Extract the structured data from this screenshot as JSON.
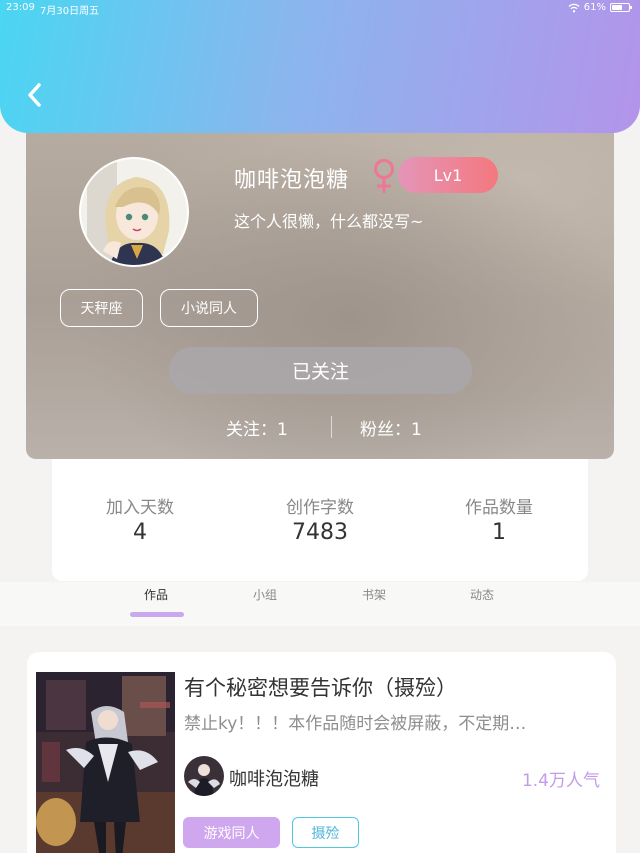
{
  "status_bar": {
    "time": "23:09",
    "date": "7月30日周五",
    "battery": "61%"
  },
  "profile": {
    "username": "咖啡泡泡糖",
    "gender_icon": "female-icon",
    "level": "Lv1",
    "bio": "这个人很懒，什么都没写~",
    "tags": [
      "天秤座",
      "小说同人"
    ],
    "follow_label": "已关注",
    "following_label": "关注：1",
    "fans_label": "粉丝：1"
  },
  "counts": [
    {
      "label": "加入天数",
      "value": "4"
    },
    {
      "label": "创作字数",
      "value": "7483"
    },
    {
      "label": "作品数量",
      "value": "1"
    }
  ],
  "tabs": [
    {
      "label": "作品"
    },
    {
      "label": "小组"
    },
    {
      "label": "书架"
    },
    {
      "label": "动态"
    }
  ],
  "work": {
    "title": "有个秘密想要告诉你（摄殓）",
    "description": "禁止ky！！！本作品随时会被屏蔽，不定期…",
    "author": "咖啡泡泡糖",
    "popularity": "1.4万人气",
    "tags": [
      "游戏同人",
      "摄殓"
    ]
  },
  "colors": {
    "header_gradient_start": "#4ad6f2",
    "header_gradient_end": "#b394ea",
    "accent_purple": "#c9a8ee",
    "level_badge": "#f4787e",
    "tag_blue": "#4fc7e2"
  }
}
